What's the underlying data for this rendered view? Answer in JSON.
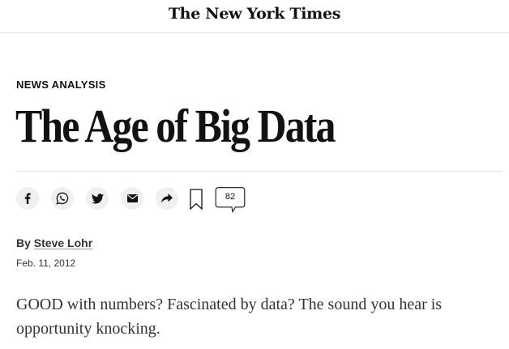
{
  "masthead": {
    "logo_text": "The New York Times"
  },
  "article": {
    "kicker": "NEWS ANALYSIS",
    "headline": "The Age of Big Data",
    "byline_prefix": "By",
    "author": "Steve Lohr",
    "date": "Feb. 11, 2012",
    "body": "GOOD with numbers? Fascinated by data? The sound you hear is opportunity knocking."
  },
  "share_bar": {
    "buttons": [
      {
        "icon": "facebook-icon"
      },
      {
        "icon": "whatsapp-icon"
      },
      {
        "icon": "twitter-icon"
      },
      {
        "icon": "email-icon"
      },
      {
        "icon": "share-arrow-icon"
      }
    ],
    "save_icon": "bookmark-icon",
    "comments_count": "82"
  },
  "colors": {
    "text": "#121212",
    "byline": "#333333",
    "rule": "#e2e2e2",
    "icon_bg": "#f0f0f0"
  }
}
